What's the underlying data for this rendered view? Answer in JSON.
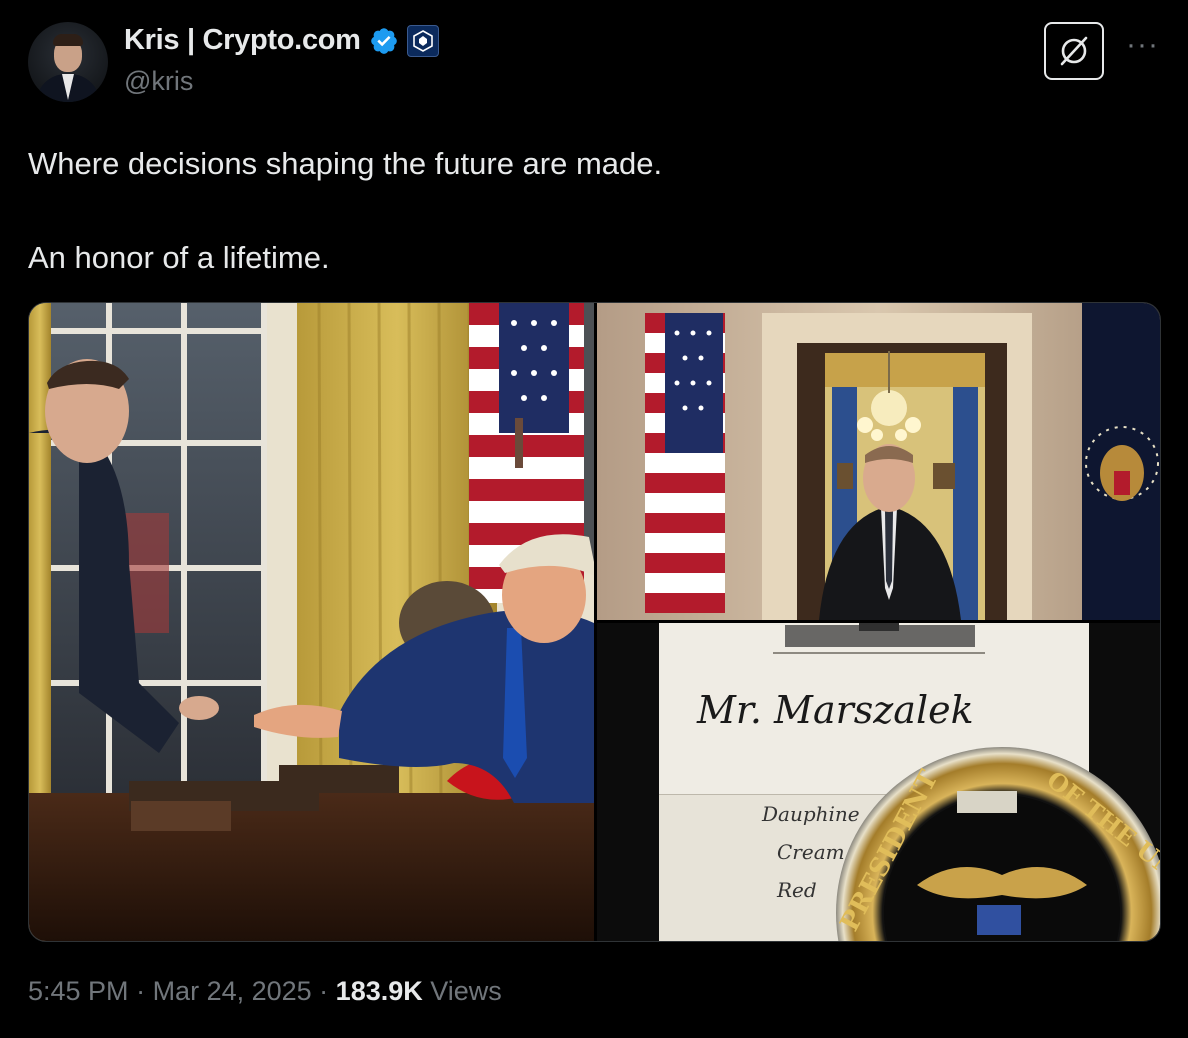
{
  "author": {
    "display_name": "Kris | Crypto.com",
    "handle": "@kris",
    "verified_icon": "verified-badge-icon",
    "affiliation_icon": "crypto-com-logo-icon"
  },
  "actions": {
    "grok_icon": "grok-icon",
    "more_icon": "more-options-icon",
    "more_glyph": "···"
  },
  "tweet": {
    "lines": [
      "Where decisions shaping the future are made.",
      "An honor of a lifetime."
    ]
  },
  "media": {
    "photos": [
      {
        "name": "oval-office-photo"
      },
      {
        "name": "blue-room-portrait-photo"
      },
      {
        "name": "place-card-coin-photo"
      }
    ],
    "place_card_text": "Mr. Marszalek",
    "menu_text": [
      "Dauphine",
      "Cream",
      "Red"
    ],
    "coin_text_left": "PRESIDENT",
    "coin_text_right": "OF THE UNITED"
  },
  "footer": {
    "time": "5:45 PM",
    "sep1": " · ",
    "date": "Mar 24, 2025",
    "sep2": " · ",
    "views_count": "183.9K",
    "views_label": " Views"
  },
  "colors": {
    "background": "#000000",
    "text": "#e7e9ea",
    "muted": "#71767b",
    "verified_blue": "#1d9bf0",
    "border": "#2f3336"
  }
}
